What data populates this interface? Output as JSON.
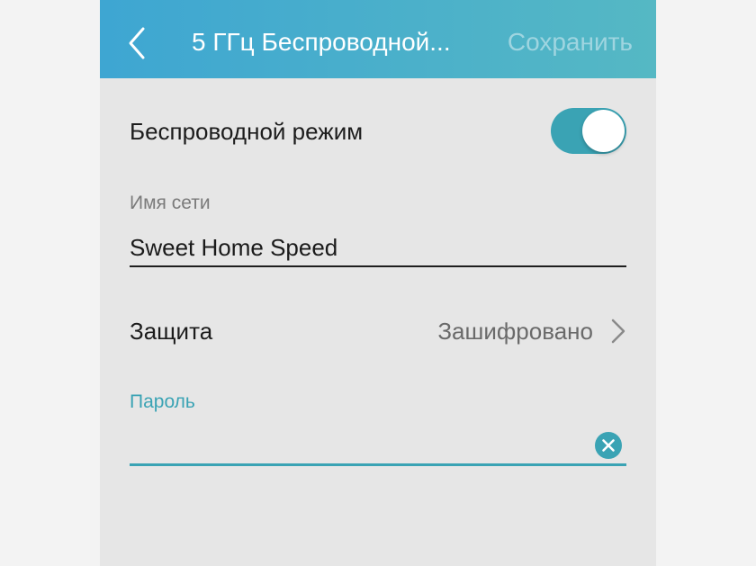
{
  "colors": {
    "accent": "#3aa3b4",
    "header_start": "#3ea6d2",
    "header_end": "#55b8c4",
    "background": "#e6e6e6"
  },
  "header": {
    "title": "5 ГГц Беспроводной...",
    "save_label": "Сохранить",
    "back_icon": "chevron-left-icon"
  },
  "wireless": {
    "label": "Беспроводной режим",
    "enabled": true
  },
  "network_name": {
    "label": "Имя сети",
    "value": "Sweet Home Speed"
  },
  "security": {
    "label": "Защита",
    "value": "Зашифровано",
    "icon": "chevron-right-icon"
  },
  "password": {
    "label": "Пароль",
    "value": "",
    "clear_icon": "clear-icon"
  }
}
